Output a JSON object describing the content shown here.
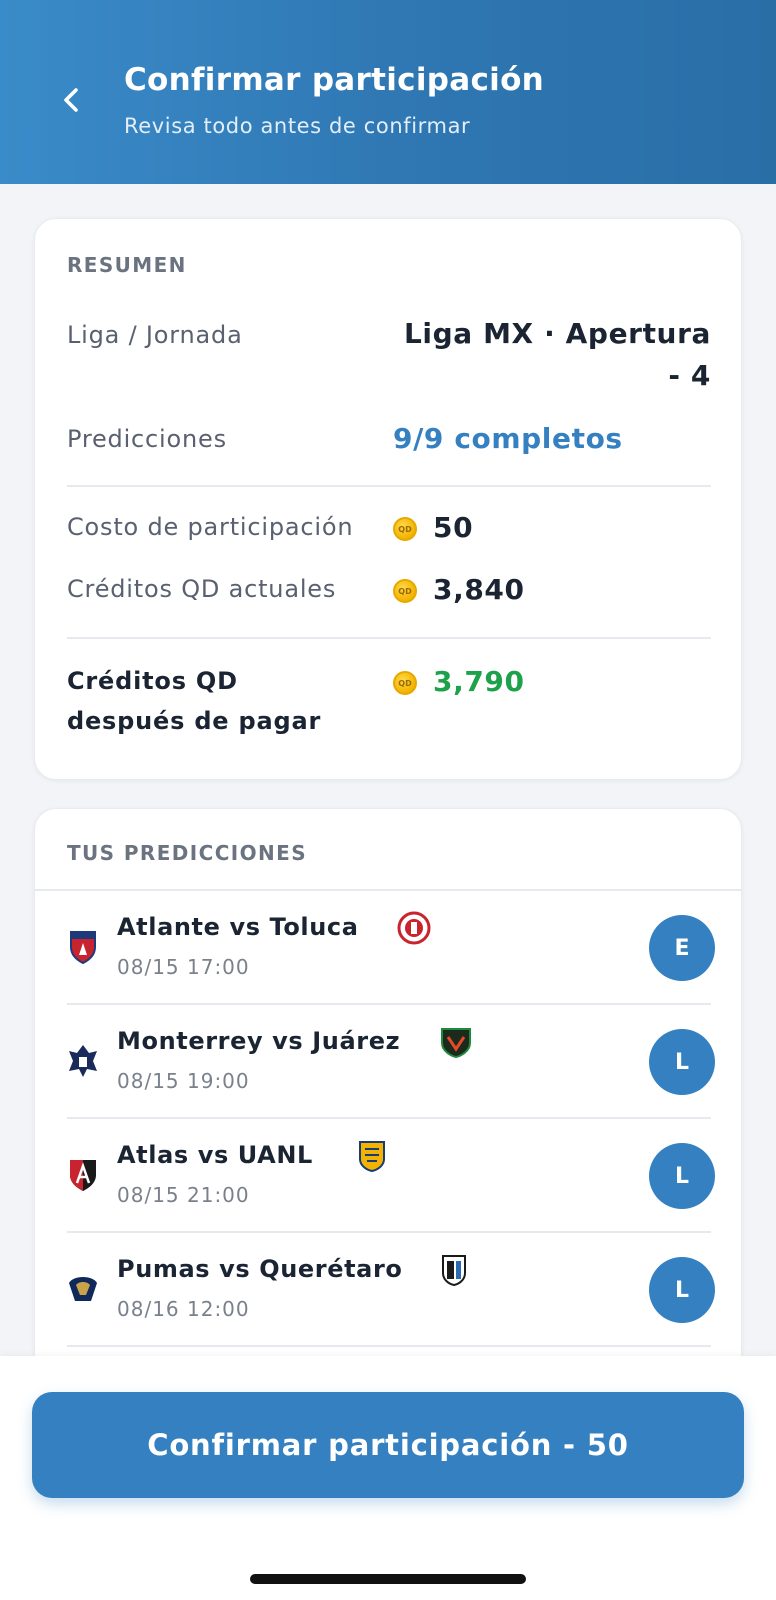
{
  "header": {
    "title": "Confirmar participación",
    "subtitle": "Revisa todo antes de confirmar",
    "back_icon": "chevron-left-icon"
  },
  "summary": {
    "section_label": "RESUMEN",
    "league_label": "Liga / Jornada",
    "league_value_line1": "Liga MX · Apertura",
    "league_value_line2": "- 4",
    "predictions_label": "Predicciones",
    "predictions_value": "9/9 completos",
    "cost_label": "Costo de participación",
    "cost_value": "50",
    "current_label": "Créditos QD actuales",
    "current_value": "3,840",
    "after_label_line1": "Créditos QD",
    "after_label_line2": "después de pagar",
    "after_value": "3,790",
    "coin_text": "QD"
  },
  "predictions": {
    "section_label": "TUS PREDICCIONES",
    "items": [
      {
        "title": "Atlante vs Toluca",
        "time": "08/15 17:00",
        "pick": "E"
      },
      {
        "title": "Monterrey vs Juárez",
        "time": "08/15 19:00",
        "pick": "L"
      },
      {
        "title": "Atlas vs UANL",
        "time": "08/15 21:00",
        "pick": "L"
      },
      {
        "title": "Pumas vs Querétaro",
        "time": "08/16 12:00",
        "pick": "L"
      }
    ]
  },
  "footer": {
    "confirm_label": "Confirmar participación - 50"
  },
  "colors": {
    "primary": "#3580c1",
    "accent_text": "#3580c1",
    "success": "#1ea14b",
    "coin": "#f2b400"
  }
}
